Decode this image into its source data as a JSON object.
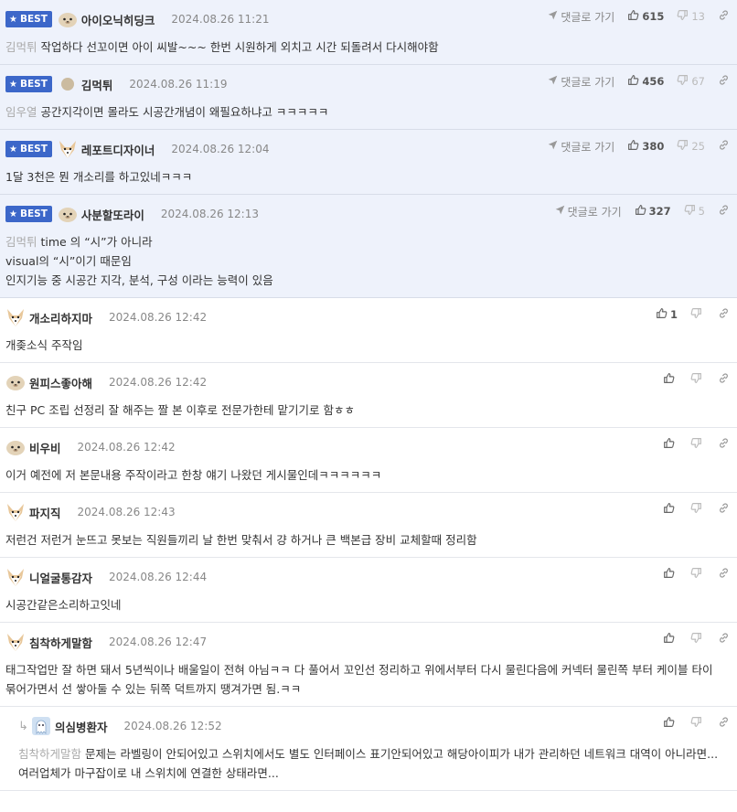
{
  "labels": {
    "best": "BEST",
    "goto": "댓글로 가기"
  },
  "colors": {
    "best_bg": "#eef2fb",
    "badge": "#3c67c9",
    "mention": "#aaaaaa"
  },
  "comments": [
    {
      "best": true,
      "avatar": "ball-avatar",
      "nick": "아이오닉히딩크",
      "date": "2024.08.26 11:21",
      "likes": "615",
      "dislikes": "13",
      "lines": [
        {
          "mention": "김먹튀",
          "text": "작업하다 선꼬이면 아이 씨발~~~ 한번 시원하게 외치고 시간 되돌려서 다시해야함"
        }
      ]
    },
    {
      "best": true,
      "avatar": "dot-avatar",
      "nick": "김먹튀",
      "date": "2024.08.26 11:19",
      "likes": "456",
      "dislikes": "67",
      "lines": [
        {
          "mention": "임우열",
          "text": "공간지각이면 몰라도 시공간개념이 왜필요하냐고 ㅋㅋㅋㅋㅋ"
        }
      ]
    },
    {
      "best": true,
      "avatar": "dog-avatar",
      "nick": "레포트디자이너",
      "date": "2024.08.26 12:04",
      "likes": "380",
      "dislikes": "25",
      "lines": [
        {
          "mention": "",
          "text": "1달 3천은 뭔 개소리를 하고있네ㅋㅋㅋ"
        }
      ]
    },
    {
      "best": true,
      "avatar": "ball-avatar",
      "nick": "사분할또라이",
      "date": "2024.08.26 12:13",
      "likes": "327",
      "dislikes": "5",
      "lines": [
        {
          "mention": "김먹튀",
          "text": "time 의 “시”가 아니라"
        },
        {
          "mention": "",
          "text": "visual의 “시”이기 때문임"
        },
        {
          "mention": "",
          "text": "인지기능 중 시공간 지각, 분석, 구성 이라는 능력이 있음"
        }
      ]
    },
    {
      "best": false,
      "avatar": "dog-avatar",
      "nick": "개소리하지마",
      "date": "2024.08.26 12:42",
      "likes": "1",
      "dislikes": "",
      "lines": [
        {
          "mention": "",
          "text": "개좆소식 주작임"
        }
      ]
    },
    {
      "best": false,
      "avatar": "ball-avatar",
      "nick": "원피스좋아해",
      "date": "2024.08.26 12:42",
      "likes": "",
      "dislikes": "",
      "lines": [
        {
          "mention": "",
          "text": "친구 PC 조립 선정리 잘 해주는 짤 본 이후로 전문가한테 맡기기로 함ㅎㅎ"
        }
      ]
    },
    {
      "best": false,
      "avatar": "ball-avatar",
      "nick": "비우비",
      "date": "2024.08.26 12:42",
      "likes": "",
      "dislikes": "",
      "lines": [
        {
          "mention": "",
          "text": "이거 예전에 저 본문내용 주작이라고 한창 얘기 나왔던 게시물인데ㅋㅋㅋㅋㅋㅋ"
        }
      ]
    },
    {
      "best": false,
      "avatar": "dog-avatar",
      "nick": "파지직",
      "date": "2024.08.26 12:43",
      "likes": "",
      "dislikes": "",
      "lines": [
        {
          "mention": "",
          "text": "저런건 저런거 눈뜨고 못보는 직원들끼리 날 한번 맞춰서 걍 하거나 큰 백본급 장비 교체할때 정리함"
        }
      ]
    },
    {
      "best": false,
      "avatar": "dog-avatar",
      "nick": "니얼굴통감자",
      "date": "2024.08.26 12:44",
      "likes": "",
      "dislikes": "",
      "lines": [
        {
          "mention": "",
          "text": "시공간같은소리하고잇네"
        }
      ]
    },
    {
      "best": false,
      "avatar": "dog-avatar",
      "nick": "침착하게말함",
      "date": "2024.08.26 12:47",
      "likes": "",
      "dislikes": "",
      "lines": [
        {
          "mention": "",
          "text": "태그작업만 잘 하면 돼서 5년씩이나 배울일이 전혀 아님ㅋㅋ 다 풀어서 꼬인선 정리하고 위에서부터 다시 물린다음에 커넥터 물린쪽 부터 케이블 타이 묶어가면서 선 쌓아둘 수 있는 뒤쪽 덕트까지 땡겨가면 됨.ㅋㅋ"
        }
      ]
    },
    {
      "best": false,
      "reply": true,
      "avatar": "ghost-avatar",
      "nick": "의심병환자",
      "date": "2024.08.26 12:52",
      "likes": "",
      "dislikes": "",
      "lines": [
        {
          "mention": "침착하게말함",
          "text": "문제는 라벨링이 안되어있고 스위치에서도 별도 인터페이스 표기안되어있고 해당아이피가 내가 관리하던 네트워크 대역이 아니라면... 여러업체가 마구잡이로 내 스위치에 연결한 상태라면..."
        }
      ]
    }
  ]
}
